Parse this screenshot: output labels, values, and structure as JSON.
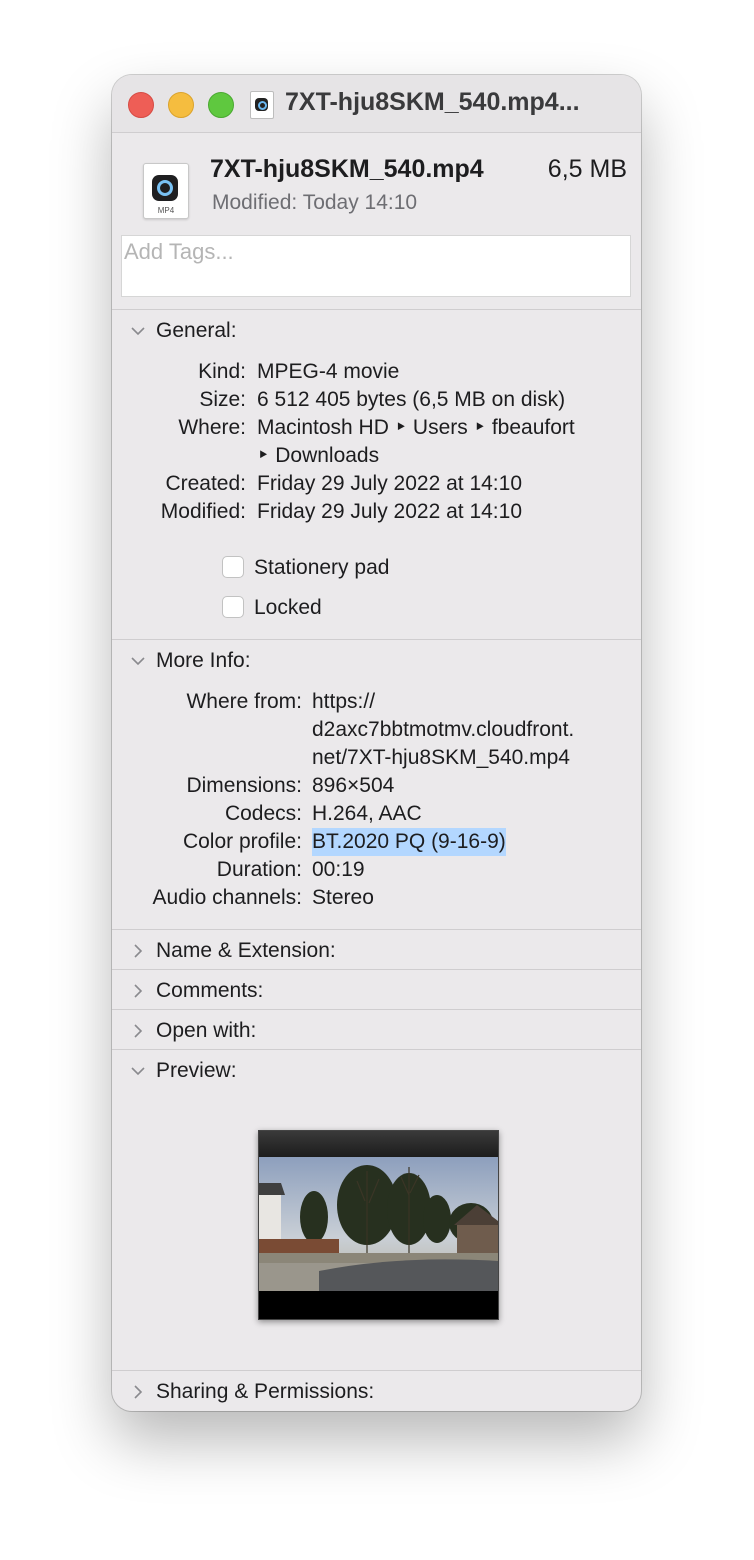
{
  "window": {
    "title": "7XT-hju8SKM_540.mp4...",
    "file_name": "7XT-hju8SKM_540.mp4",
    "file_size": "6,5 MB",
    "file_ext": "MP4",
    "modified_label": "Modified:",
    "modified_value": "Today 14:10",
    "tags_placeholder": "Add Tags..."
  },
  "general": {
    "title": "General:",
    "kind_label": "Kind:",
    "kind_value": "MPEG-4 movie",
    "size_label": "Size:",
    "size_value": "6 512 405 bytes (6,5 MB on disk)",
    "where_label": "Where:",
    "where_line1": "Macintosh HD ‣ Users ‣ fbeaufort",
    "where_line2": "‣ Downloads",
    "created_label": "Created:",
    "created_value": "Friday 29 July 2022 at 14:10",
    "modified_label": "Modified:",
    "modified_value": "Friday 29 July 2022 at 14:10",
    "stationery_label": "Stationery pad",
    "locked_label": "Locked"
  },
  "more_info": {
    "title": "More Info:",
    "where_from_label": "Where from:",
    "where_from_line1": "https://",
    "where_from_line2": "d2axc7bbtmotmv.cloudfront.",
    "where_from_line3": "net/7XT-hju8SKM_540.mp4",
    "dimensions_label": "Dimensions:",
    "dimensions_value": "896×504",
    "codecs_label": "Codecs:",
    "codecs_value": "H.264, AAC",
    "color_profile_label": "Color profile:",
    "color_profile_value": "BT.2020 PQ (9-16-9)",
    "duration_label": "Duration:",
    "duration_value": "00:19",
    "audio_label": "Audio channels:",
    "audio_value": "Stereo"
  },
  "sections": {
    "name_ext": "Name & Extension:",
    "comments": "Comments:",
    "open_with": "Open with:",
    "preview": "Preview:",
    "sharing": "Sharing & Permissions:"
  }
}
